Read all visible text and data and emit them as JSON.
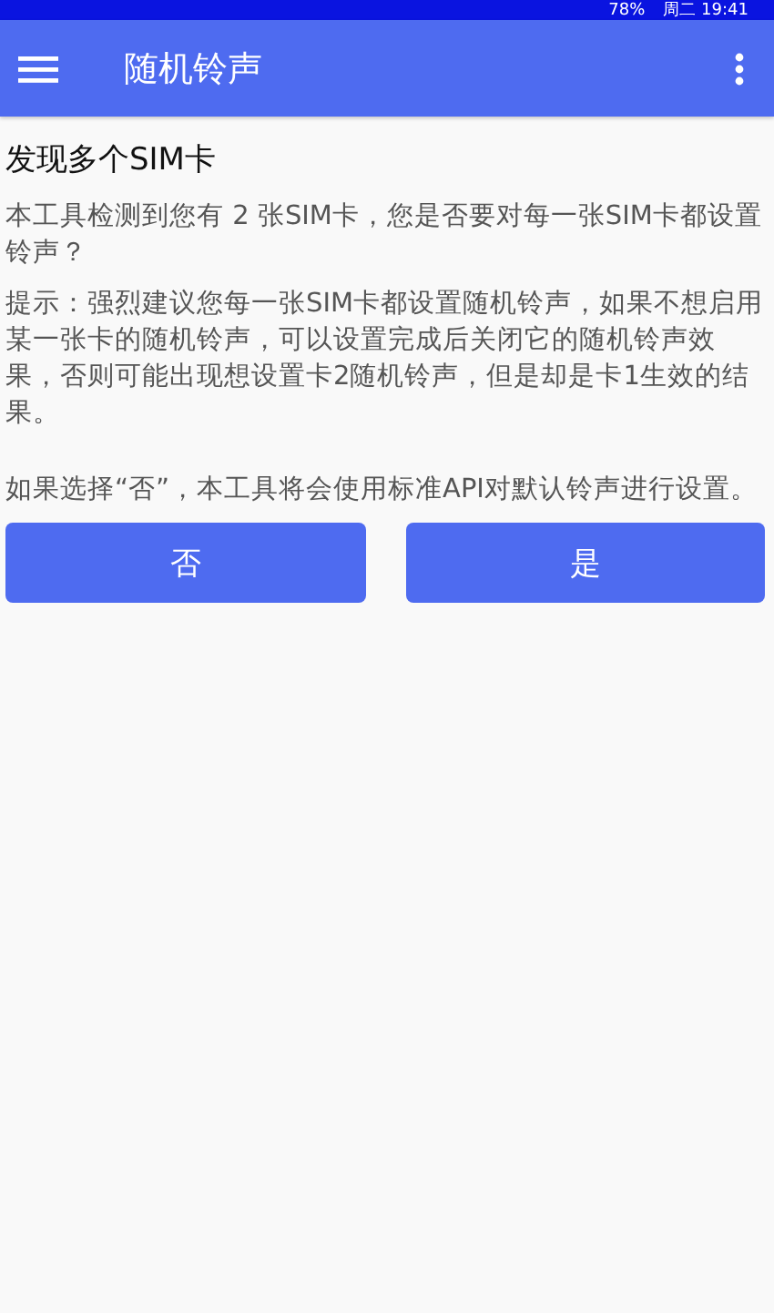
{
  "status_bar": {
    "battery": "78%",
    "clock": "周二 19:41"
  },
  "app_bar": {
    "title": "随机铃声"
  },
  "content": {
    "heading": "发现多个SIM卡",
    "paragraphs": [
      "本工具检测到您有 2 张SIM卡，您是否要对每一张SIM卡都设置铃声？",
      "提示：强烈建议您每一张SIM卡都设置随机铃声，如果不想启用某一张卡的随机铃声，可以设置完成后关闭它的随机铃声效果，否则可能出现想设置卡2随机铃声，但是却是卡1生效的结果。",
      "如果选择“否”，本工具将会使用标准API对默认铃声进行设置。"
    ]
  },
  "buttons": [
    {
      "label": "否"
    },
    {
      "label": "是"
    }
  ]
}
